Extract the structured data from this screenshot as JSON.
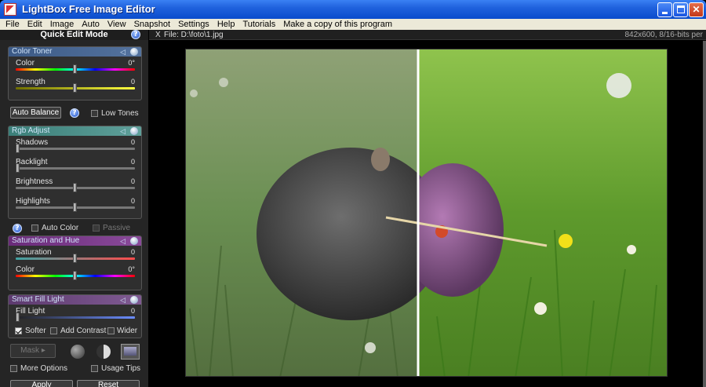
{
  "window": {
    "title": "LightBox Free Image Editor",
    "min_label": "",
    "max_label": "",
    "close_label": "✕"
  },
  "menu": [
    "File",
    "Edit",
    "Image",
    "Auto",
    "View",
    "Snapshot",
    "Settings",
    "Help",
    "Tutorials",
    "Make a copy of this program"
  ],
  "left_panel": {
    "header": "Quick Edit Mode",
    "color_toner": {
      "title": "Color Toner",
      "color_label": "Color",
      "color_value": "0°",
      "color_level": 0.5,
      "strength_label": "Strength",
      "strength_value": "0",
      "strength_level": 0.5
    },
    "auto_balance_label": "Auto Balance",
    "low_tones_label": "Low Tones",
    "rgb_adjust": {
      "title": "Rgb Adjust",
      "shadows_label": "Shadows",
      "shadows_value": "0",
      "shadows_level": 0.0,
      "backlight_label": "Backlight",
      "backlight_value": "0",
      "backlight_level": 0.0,
      "brightness_label": "Brightness",
      "brightness_value": "0",
      "brightness_level": 0.5,
      "highlights_label": "Highlights",
      "highlights_value": "0",
      "highlights_level": 0.5
    },
    "auto_color_label": "Auto Color",
    "passive_label": "Passive",
    "saturation_hue": {
      "title": "Saturation and Hue",
      "saturation_label": "Saturation",
      "saturation_value": "0",
      "saturation_level": 0.5,
      "color_label": "Color",
      "color_value": "0°",
      "color_level": 0.5
    },
    "smart_fill": {
      "title": "Smart Fill Light",
      "fill_label": "Fill Light",
      "fill_value": "0",
      "fill_level": 0.0,
      "softer_label": "Softer",
      "add_contrast_label": "Add Contrast",
      "wider_label": "Wider"
    },
    "mask_label": "Mask",
    "more_options_label": "More Options",
    "usage_tips_label": "Usage Tips",
    "apply_label": "Apply",
    "reset_label": "Reset"
  },
  "file": {
    "close_glyph": "X",
    "name": "File: D:\\foto\\1.jpg",
    "info": "842x600, 8/16-bits per"
  },
  "colors": {
    "color_toner_header": "#3c5a86",
    "rgb_header": "#3b7f79",
    "sat_header": "#6a2b7a",
    "fill_header": "#5d3a6f"
  }
}
